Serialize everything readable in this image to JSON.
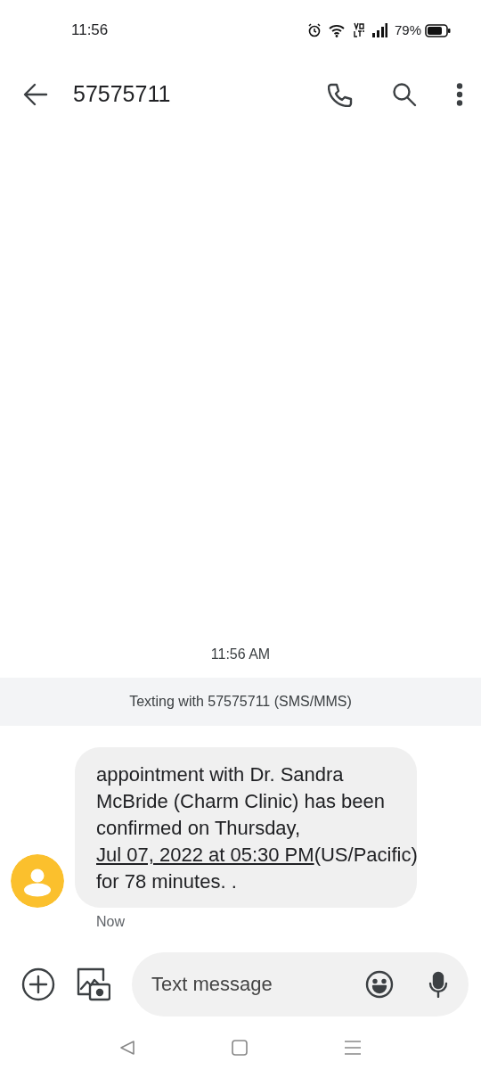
{
  "status_bar": {
    "time": "11:56",
    "battery_text": "79%"
  },
  "header": {
    "title": "57575711"
  },
  "timestamp": "11:56 AM",
  "banner": "Texting with 57575711 (SMS/MMS)",
  "message": {
    "parts": [
      {
        "kind": "text",
        "text": "appointment with Dr. Sandra McBride (Charm Clinic) has been confirmed on Thursday, "
      },
      {
        "kind": "link",
        "text": "Jul 07, 2022 at 05:30 PM"
      },
      {
        "kind": "text",
        "text": "(US/Pacific) for 78 minutes. ."
      }
    ],
    "time": "Now"
  },
  "composer": {
    "placeholder": "Text message"
  }
}
